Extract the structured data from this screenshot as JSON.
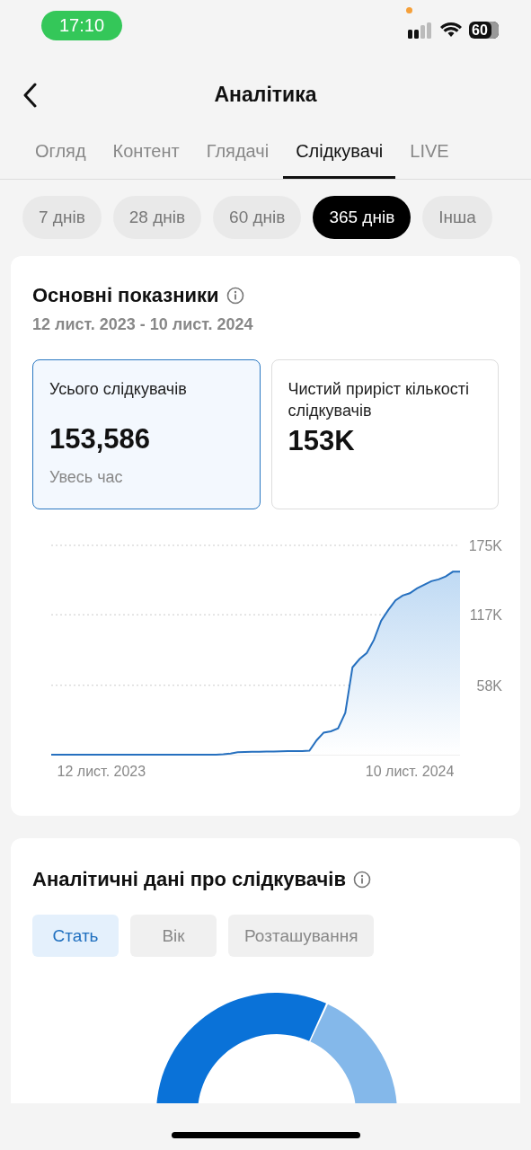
{
  "status_bar": {
    "time": "17:10",
    "battery": "60"
  },
  "header": {
    "title": "Аналітика"
  },
  "tabs": [
    {
      "label": "Огляд",
      "selected": false
    },
    {
      "label": "Контент",
      "selected": false
    },
    {
      "label": "Глядачі",
      "selected": false
    },
    {
      "label": "Слідкувачі",
      "selected": true
    },
    {
      "label": "LIVE",
      "selected": false
    }
  ],
  "periods": [
    {
      "label": "7 днів",
      "selected": false
    },
    {
      "label": "28 днів",
      "selected": false
    },
    {
      "label": "60 днів",
      "selected": false
    },
    {
      "label": "365 днів",
      "selected": true
    },
    {
      "label": "Інша",
      "selected": false
    }
  ],
  "key_metrics": {
    "title": "Основні показники",
    "date_range": "12 лист. 2023 - 10 лист. 2024",
    "metrics": [
      {
        "label": "Усього слідкувачів",
        "value": "153,586",
        "note": "Увесь час",
        "selected": true
      },
      {
        "label": "Чистий приріст кількості слідкувачів",
        "value": "153K",
        "selected": false
      }
    ],
    "chart_data": {
      "type": "area",
      "ylim": [
        0,
        175000
      ],
      "yticks": [
        {
          "value": 58000,
          "label": "58K"
        },
        {
          "value": 117000,
          "label": "117K"
        },
        {
          "value": 175000,
          "label": "175K"
        }
      ],
      "categories": [
        null,
        null,
        null,
        null,
        null,
        null,
        null,
        "12 лист. 2023",
        null,
        null,
        null,
        null,
        null,
        null,
        null,
        null,
        null,
        null,
        null,
        null,
        null,
        null,
        null,
        null,
        null,
        null,
        null,
        null,
        null,
        null,
        null,
        null,
        null,
        null,
        null,
        null,
        null,
        null,
        null,
        null,
        null,
        null,
        null,
        null,
        null,
        null,
        null,
        null,
        null,
        null,
        "10 лист. 2024",
        null,
        null,
        null,
        null,
        null,
        null,
        null
      ],
      "values": [
        0,
        0,
        0,
        0,
        0,
        0,
        0,
        0,
        0,
        0,
        0,
        0,
        0,
        0,
        0,
        0,
        0,
        0,
        0,
        0,
        0,
        0,
        0,
        0,
        300,
        1000,
        2000,
        2300,
        2400,
        2500,
        2600,
        2700,
        2800,
        2900,
        3000,
        3100,
        3300,
        12000,
        18500,
        19500,
        22000,
        35000,
        73000,
        80000,
        85000,
        96000,
        112000,
        121000,
        129000,
        133000,
        135000,
        139000,
        142000,
        145000,
        146500,
        149000,
        153000,
        153000
      ]
    }
  },
  "follower_insights": {
    "title": "Аналітичні дані про слідкувачів",
    "segments": [
      {
        "label": "Стать",
        "selected": true
      },
      {
        "label": "Вік",
        "selected": false
      },
      {
        "label": "Розташування",
        "selected": false
      }
    ]
  }
}
